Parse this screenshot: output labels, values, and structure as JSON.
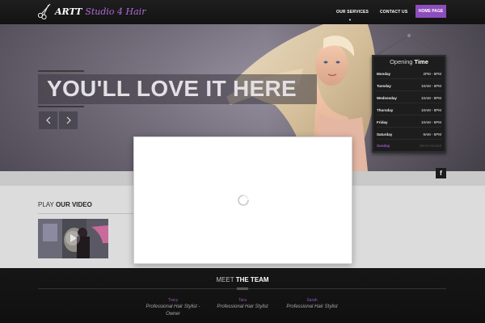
{
  "header": {
    "logo_text": "ARTT",
    "logo_accent": "Studio 4 Hair",
    "nav": {
      "services": "OUR SERVICES",
      "contact": "CONTACT US",
      "home": "HOME PAGE"
    }
  },
  "hero": {
    "slogan": "YOU'LL LOVE IT HERE"
  },
  "opening": {
    "title_main": "Opening",
    "title_bold": "Time",
    "rows": [
      {
        "day": "Monday",
        "time": "2PM - 8PM"
      },
      {
        "day": "Tuesday",
        "time": "10AM - 6PM"
      },
      {
        "day": "Wednesday",
        "time": "10AM - 8PM"
      },
      {
        "day": "Thursday",
        "time": "10AM - 8PM"
      },
      {
        "day": "Friday",
        "time": "10AM - 6PM"
      },
      {
        "day": "Saturday",
        "time": "9AM - 5PM"
      },
      {
        "day": "Sunday",
        "time": "We're Closed"
      }
    ]
  },
  "video": {
    "title_plain": "PLAY",
    "title_bold": "OUR VIDEO"
  },
  "team": {
    "title_plain": "MEET",
    "title_bold": "THE TEAM",
    "members": [
      {
        "name": "Tracy",
        "role": "Professional Hair Stylist - Owner"
      },
      {
        "name": "Tara",
        "role": "Professional Hair Stylist"
      },
      {
        "name": "Sarah",
        "role": "Professional Hair Stylist"
      }
    ]
  },
  "colors": {
    "accent": "#8d4dbd",
    "accent_text": "#b06ad9"
  },
  "icons": [
    "scissors-icon",
    "chevron-left-icon",
    "chevron-right-icon",
    "facebook-icon",
    "loading-spinner-icon",
    "play-icon"
  ]
}
